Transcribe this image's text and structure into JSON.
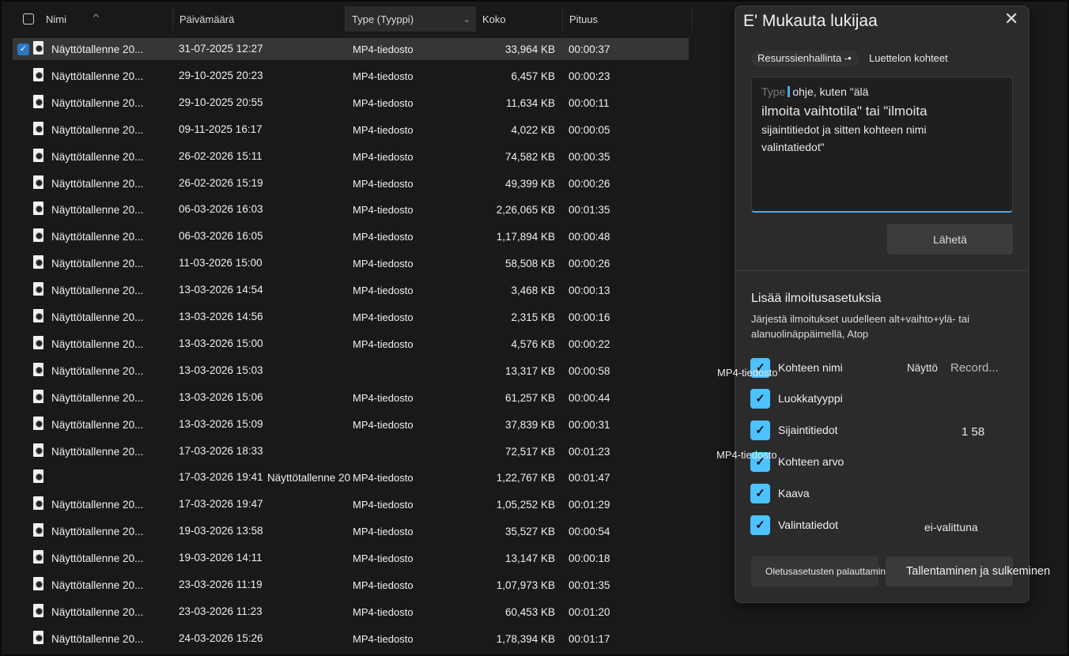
{
  "header": {
    "name": "Nimi",
    "date": "Päivämäärä",
    "type": "Type (Tyyppi)",
    "size": "Koko",
    "length": "Pituus"
  },
  "rows": [
    {
      "name": "Näyttötallenne 20...",
      "date": "31-07-2025 12:27",
      "type": "MP4-tiedosto",
      "size": "33,964 KB",
      "length": "00:00:37",
      "selected": true
    },
    {
      "name": "Näyttötallenne 20...",
      "date": "29-10-2025 20:23",
      "type": "MP4-tiedosto",
      "size": "6,457 KB",
      "length": "00:00:23"
    },
    {
      "name": "Näyttötallenne 20...",
      "date": "29-10-2025 20:55",
      "type": "MP4-tiedosto",
      "size": "11,634 KB",
      "length": "00:00:11"
    },
    {
      "name": "Näyttötallenne 20...",
      "date": "09-11-2025 16:17",
      "type": "MP4-tiedosto",
      "size": "4,022 KB",
      "length": "00:00:05"
    },
    {
      "name": "Näyttötallenne 20...",
      "date": "26-02-2026 15:11",
      "type": "MP4-tiedosto",
      "size": "74,582 KB",
      "length": "00:00:35"
    },
    {
      "name": "Näyttötallenne 20...",
      "date": "26-02-2026 15:19",
      "type": "MP4-tiedosto",
      "size": "49,399 KB",
      "length": "00:00:26"
    },
    {
      "name": "Näyttötallenne 20...",
      "date": "06-03-2026 16:03",
      "type": "MP4-tiedosto",
      "size": "2,26,065 KB",
      "length": "00:01:35"
    },
    {
      "name": "Näyttötallenne 20...",
      "date": "06-03-2026 16:05",
      "type": "MP4-tiedosto",
      "size": "1,17,894 KB",
      "length": "00:00:48"
    },
    {
      "name": "Näyttötallenne 20...",
      "date": "11-03-2026 15:00",
      "type": "MP4-tiedosto",
      "size": "58,508 KB",
      "length": "00:00:26"
    },
    {
      "name": "Näyttötallenne 20...",
      "date": "13-03-2026 14:54",
      "type": "MP4-tiedosto",
      "size": "3,468 KB",
      "length": "00:00:13"
    },
    {
      "name": "Näyttötallenne 20...",
      "date": "13-03-2026 14:56",
      "type": "MP4-tiedosto",
      "size": "2,315 KB",
      "length": "00:00:16"
    },
    {
      "name": "Näyttötallenne 20...",
      "date": "13-03-2026 15:00",
      "type": "MP4-tiedosto",
      "size": "4,576 KB",
      "length": "00:00:22"
    },
    {
      "name": "Näyttötallenne 20...",
      "date": "13-03-2026 15:03",
      "type": "",
      "size": "13,317 KB",
      "length": "00:00:58"
    },
    {
      "name": "Näyttötallenne 20...",
      "date": "13-03-2026 15:06",
      "type": "MP4-tiedosto",
      "size": "61,257 KB",
      "length": "00:00:44"
    },
    {
      "name": "Näyttötallenne 20...",
      "date": "13-03-2026 15:09",
      "type": "MP4-tiedosto",
      "size": "37,839 KB",
      "length": "00:00:31"
    },
    {
      "name": "Näyttötallenne 20...",
      "date": "17-03-2026 18:33",
      "type": "",
      "size": "72,517 KB",
      "length": "00:01:23"
    },
    {
      "name": "",
      "date": "17-03-2026 19:41",
      "name2": "Näyttötallenne 20",
      "type": "MP4-tiedosto",
      "size": "1,22,767 KB",
      "length": "00:01:47"
    },
    {
      "name": "Näyttötallenne 20...",
      "date": "17-03-2026 19:47",
      "type": "MP4-tiedosto",
      "size": "1,05,252 KB",
      "length": "00:01:29"
    },
    {
      "name": "Näyttötallenne 20...",
      "date": "19-03-2026 13:58",
      "type": "MP4-tiedosto",
      "size": "35,527 KB",
      "length": "00:00:54"
    },
    {
      "name": "Näyttötallenne 20...",
      "date": "19-03-2026 14:11",
      "type": "MP4-tiedosto",
      "size": "13,147 KB",
      "length": "00:00:18"
    },
    {
      "name": "Näyttötallenne 20...",
      "date": "23-03-2026 11:19",
      "type": "MP4-tiedosto",
      "size": "1,07,973 KB",
      "length": "00:01:35"
    },
    {
      "name": "Näyttötallenne 20...",
      "date": "23-03-2026 11:23",
      "type": "MP4-tiedosto",
      "size": "60,453 KB",
      "length": "00:01:20"
    },
    {
      "name": "Näyttötallenne 20...",
      "date": "24-03-2026 15:26",
      "type": "MP4-tiedosto",
      "size": "1,78,394 KB",
      "length": "00:01:17"
    }
  ],
  "dialog": {
    "title": "E' Mukauta lukijaa",
    "close_glyph": "✕",
    "pill_explorer": "Resurssienhallinta -•",
    "pill_items": "Luettelon kohteet",
    "textarea": {
      "placeholder_start": "Type",
      "line1": "ohje, kuten \"älä",
      "line2": "ilmoita vaihtotila\" tai \"ilmoita",
      "line3": "sijaintitiedot ja sitten kohteen nimi",
      "line4": "valintatiedot\""
    },
    "send_label": "Lähetä",
    "section_title": "Lisää ilmoitusasetuksia",
    "section_desc": "Järjestä ilmoitukset uudelleen alt+vaihto+ylä- tai alanuolinäppäimellä, Atop",
    "options": [
      {
        "label": "Kohteen nimi",
        "checked": true
      },
      {
        "label": "Luokkatyyppi",
        "checked": true
      },
      {
        "label": "Sijaintitiedot",
        "checked": true
      },
      {
        "label": "Kohteen arvo",
        "checked": true
      },
      {
        "label": "Kaava",
        "checked": true
      },
      {
        "label": "Valintatiedot",
        "checked": true
      }
    ],
    "preview": {
      "type1": "MP4-tiedosto",
      "name_word": "Näyttö",
      "name_record": "Record...",
      "position": "1 58",
      "type2": "MP4-tiedosto",
      "selection_state": "ei-valittuna"
    },
    "reset_label": "Oletusasetusten palauttaminen",
    "save_label": "Tallentaminen ja sulkeminen"
  }
}
